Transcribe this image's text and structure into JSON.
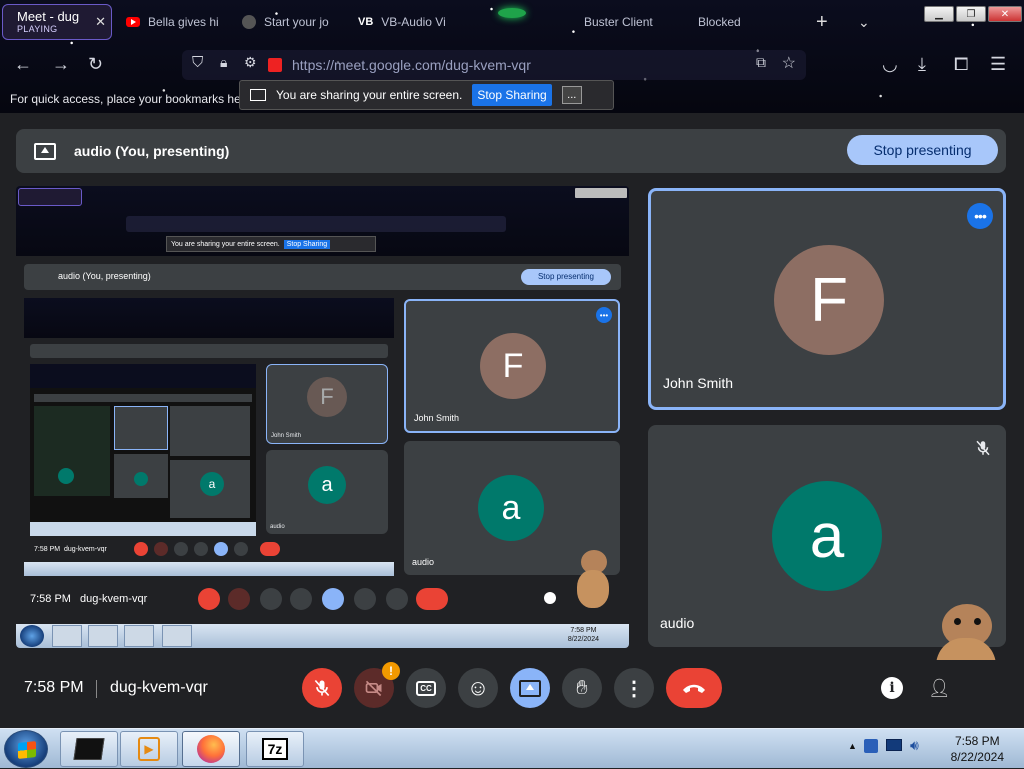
{
  "browser": {
    "tabs": [
      {
        "title": "Meet - dug",
        "status": "PLAYING",
        "icon": "google-meet-icon",
        "active": true
      },
      {
        "title": "Bella gives hi",
        "icon": "youtube-icon",
        "active": false
      },
      {
        "title": "Start your jo",
        "icon": "globe-icon",
        "active": false
      },
      {
        "title": "VB-Audio Vi",
        "icon": "vb-audio-icon",
        "active": false
      },
      {
        "title": "Buster Client",
        "icon": "",
        "active": false
      },
      {
        "title": "Blocked",
        "icon": "",
        "active": false
      }
    ],
    "url": "https://meet.google.com/dug-kvem-vqr",
    "bookmarks_hint": "For quick access, place your bookmarks her",
    "vb_label": "VB"
  },
  "share_notice": {
    "text": "You are sharing your entire screen.",
    "stop_label": "Stop Sharing",
    "more_label": "..."
  },
  "presenting_bar": {
    "label": "audio (You, presenting)",
    "stop_label": "Stop presenting"
  },
  "mirror": {
    "share_text": "You are sharing your entire screen.",
    "stop_sharing": "Stop Sharing",
    "presenting_label": "audio (You, presenting)",
    "stop_presenting": "Stop presenting",
    "time": "7:58 PM",
    "code": "dug-kvem-vqr",
    "john": "John Smith",
    "audio": "audio",
    "clock_time": "7:58 PM",
    "clock_date": "8/22/2024"
  },
  "participants": [
    {
      "name": "John Smith",
      "initial": "F",
      "avatar_color": "#8d6e63",
      "active_speaker": true
    },
    {
      "name": "audio",
      "initial": "a",
      "avatar_color": "#00796b",
      "muted": true
    }
  ],
  "controls": {
    "time": "7:58 PM",
    "meeting_code": "dug-kvem-vqr",
    "camera_badge": "!"
  },
  "taskbar": {
    "clock_time": "7:58 PM",
    "clock_date": "8/22/2024",
    "apps": [
      "terminal-icon",
      "media-player-icon",
      "firefox-icon",
      "7zip-icon"
    ],
    "zip_label": "7z"
  },
  "colors": {
    "meet_bg": "#202124",
    "tile_bg": "#3c4043",
    "accent_blue": "#8ab4f8",
    "stop_presenting_bg": "#a8c7fa",
    "danger": "#ea4335"
  }
}
